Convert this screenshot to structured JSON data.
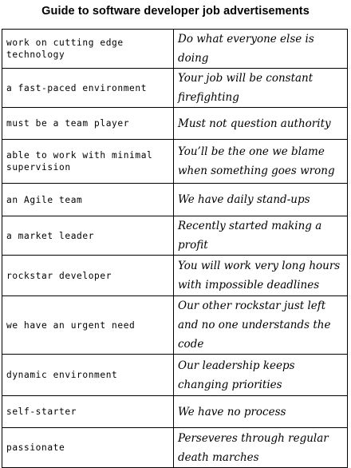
{
  "title": "Guide to software developer job advertisements",
  "rows": [
    {
      "phrase": "work on cutting edge technology",
      "meaning": "Do what everyone else is doing"
    },
    {
      "phrase": "a fast-paced environment",
      "meaning": "Your job will be constant firefighting"
    },
    {
      "phrase": "must be a team player",
      "meaning": "Must not question authority"
    },
    {
      "phrase": "able to work with minimal supervision",
      "meaning": "You’ll be the one we blame when something goes wrong"
    },
    {
      "phrase": "an Agile team",
      "meaning": "We have daily stand-ups"
    },
    {
      "phrase": "a market leader",
      "meaning": "Recently started making a profit"
    },
    {
      "phrase": "rockstar developer",
      "meaning": "You will work very long hours with impossible deadlines"
    },
    {
      "phrase": "we have an urgent need",
      "meaning": "Our other rockstar just left and no one understands the code"
    },
    {
      "phrase": "dynamic environment",
      "meaning": "Our leadership keeps changing priorities"
    },
    {
      "phrase": "self-starter",
      "meaning": "We have no process"
    },
    {
      "phrase": "passionate",
      "meaning": "Perseveres through regular death marches"
    }
  ]
}
